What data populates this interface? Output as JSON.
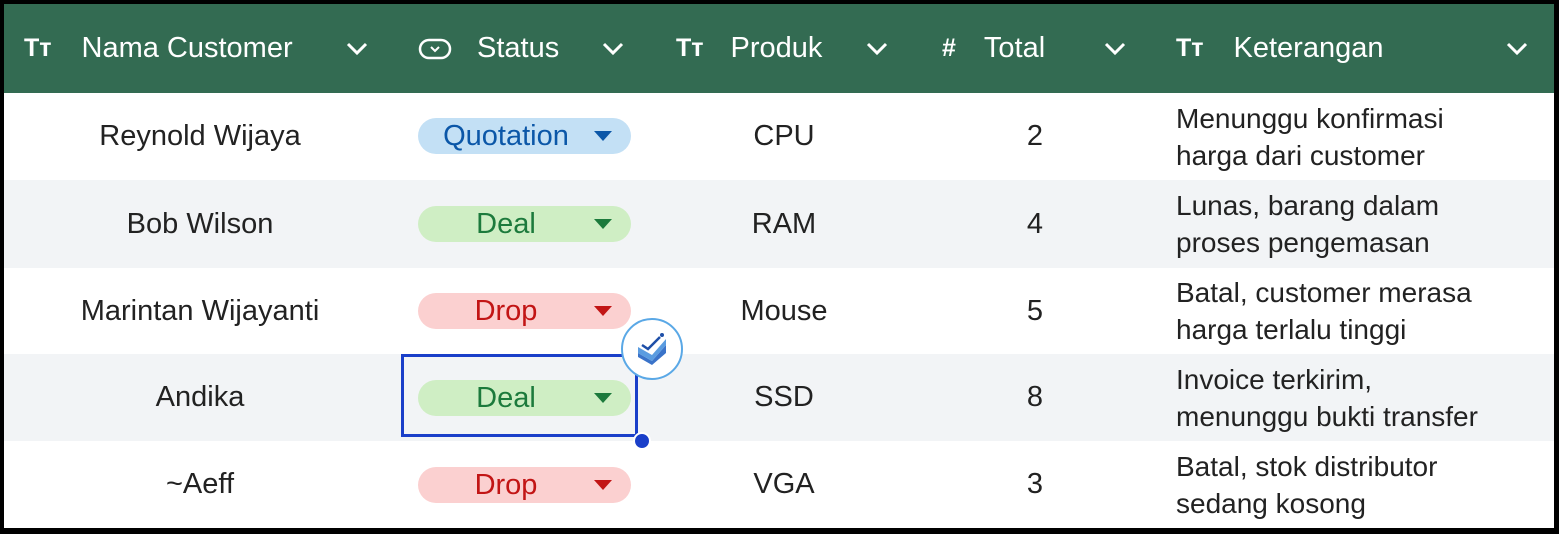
{
  "header": {
    "columns": [
      {
        "icon": "text-type-icon",
        "glyph": "Tт",
        "label": "Nama Customer"
      },
      {
        "icon": "dropdown-chip-icon",
        "glyph": "",
        "label": "Status"
      },
      {
        "icon": "text-type-icon",
        "glyph": "Tт",
        "label": "Produk"
      },
      {
        "icon": "number-type-icon",
        "glyph": "#",
        "label": "Total"
      },
      {
        "icon": "text-type-icon",
        "glyph": "Tт",
        "label": "Keterangan"
      }
    ]
  },
  "rows": [
    {
      "customer": "Reynold Wijaya",
      "status": "Quotation",
      "produk": "CPU",
      "total": "2",
      "ket1": "Menunggu konfirmasi",
      "ket2": "harga dari customer"
    },
    {
      "customer": "Bob Wilson",
      "status": "Deal",
      "produk": "RAM",
      "total": "4",
      "ket1": "Lunas, barang dalam",
      "ket2": "proses pengemasan"
    },
    {
      "customer": "Marintan Wijayanti",
      "status": "Drop",
      "produk": "Mouse",
      "total": "5",
      "ket1": "Batal, customer merasa",
      "ket2": "harga terlalu tinggi"
    },
    {
      "customer": "Andika",
      "status": "Deal",
      "produk": "SSD",
      "total": "8",
      "ket1": "Invoice terkirim,",
      "ket2": "menunggu bukti transfer"
    },
    {
      "customer": "~Aeff",
      "status": "Drop",
      "produk": "VGA",
      "total": "3",
      "ket1": "Batal, stok distributor",
      "ket2": "sedang kosong"
    }
  ],
  "colors": {
    "header_bg": "#336b52",
    "quotation_bg": "#c3e0f5",
    "quotation_text": "#0b57a8",
    "deal_bg": "#cfeec4",
    "deal_text": "#1c7a3c",
    "drop_bg": "#fbd0d0",
    "drop_text": "#c21515",
    "selection": "#1a3fc9"
  }
}
